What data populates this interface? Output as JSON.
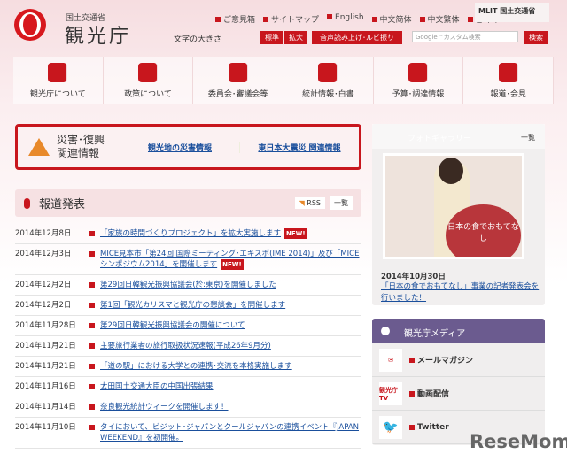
{
  "header": {
    "org_sub": "国土交通省",
    "org": "観光庁",
    "links": [
      "ご意見箱",
      "サイトマップ",
      "English",
      "中文简体",
      "中文繁体",
      "한국어"
    ],
    "mlit": "MLIT 国土交通省",
    "font_size_label": "文字の大きさ",
    "size_standard": "標準",
    "size_large": "拡大",
    "speech": "音声読み上げ･ルビ振り",
    "search_placeholder": "Google™カスタム検索",
    "search_button": "検索"
  },
  "nav": [
    "観光庁について",
    "政策について",
    "委員会･審議会等",
    "統計情報･白書",
    "予算･調達情報",
    "報道･会見"
  ],
  "alert": {
    "title1": "災害･復興",
    "title2": "関連情報",
    "link1": "観光地の災害情報",
    "link2": "東日本大震災 関連情報"
  },
  "press": {
    "title": "報道発表",
    "rss": "RSS",
    "list": "一覧",
    "new_label": "NEW!",
    "items": [
      {
        "date": "2014年12月8日",
        "text": "「家族の時間づくりプロジェクト」を拡大実施します",
        "new": true
      },
      {
        "date": "2014年12月3日",
        "text": "MICE見本市「第24回 国際ミーティング･エキスポ(IME 2014)」及び「MICEシンポジウム2014」を開催します",
        "new": true
      },
      {
        "date": "2014年12月2日",
        "text": "第29回日韓観光振興協議会(於:東京)を開催しました"
      },
      {
        "date": "2014年12月2日",
        "text": "第1回「観光カリスマと観光庁の懇談会」を開催します"
      },
      {
        "date": "2014年11月28日",
        "text": "第29回日韓観光振興協議会の開催について"
      },
      {
        "date": "2014年11月21日",
        "text": "主要旅行業者の旅行取扱状況速報(平成26年9月分)"
      },
      {
        "date": "2014年11月21日",
        "text": "「道の駅」における大学との連携･交流を本格実施します"
      },
      {
        "date": "2014年11月16日",
        "text": "太田国土交通大臣の中国出張結果"
      },
      {
        "date": "2014年11月14日",
        "text": "奈良観光統計ウィークを開催します！"
      },
      {
        "date": "2014年11月10日",
        "text": "タイにおいて、ビジット･ジャパンとクールジャパンの連携イベント『JAPAN WEEKEND』を初開催。"
      }
    ]
  },
  "gallery": {
    "title": "フォトギャラリー",
    "list": "一覧",
    "photo_text": "日本の食でおもてなし",
    "date": "2014年10月30日",
    "link": "「日本の食でおもてなし」事業の記者発表会を行いました！"
  },
  "media": {
    "title": "観光庁メディア",
    "items": [
      "メールマガジン",
      "動画配信",
      "Twitter"
    ],
    "tv_icon": "観光庁TV"
  },
  "watermark": "ReseMom"
}
